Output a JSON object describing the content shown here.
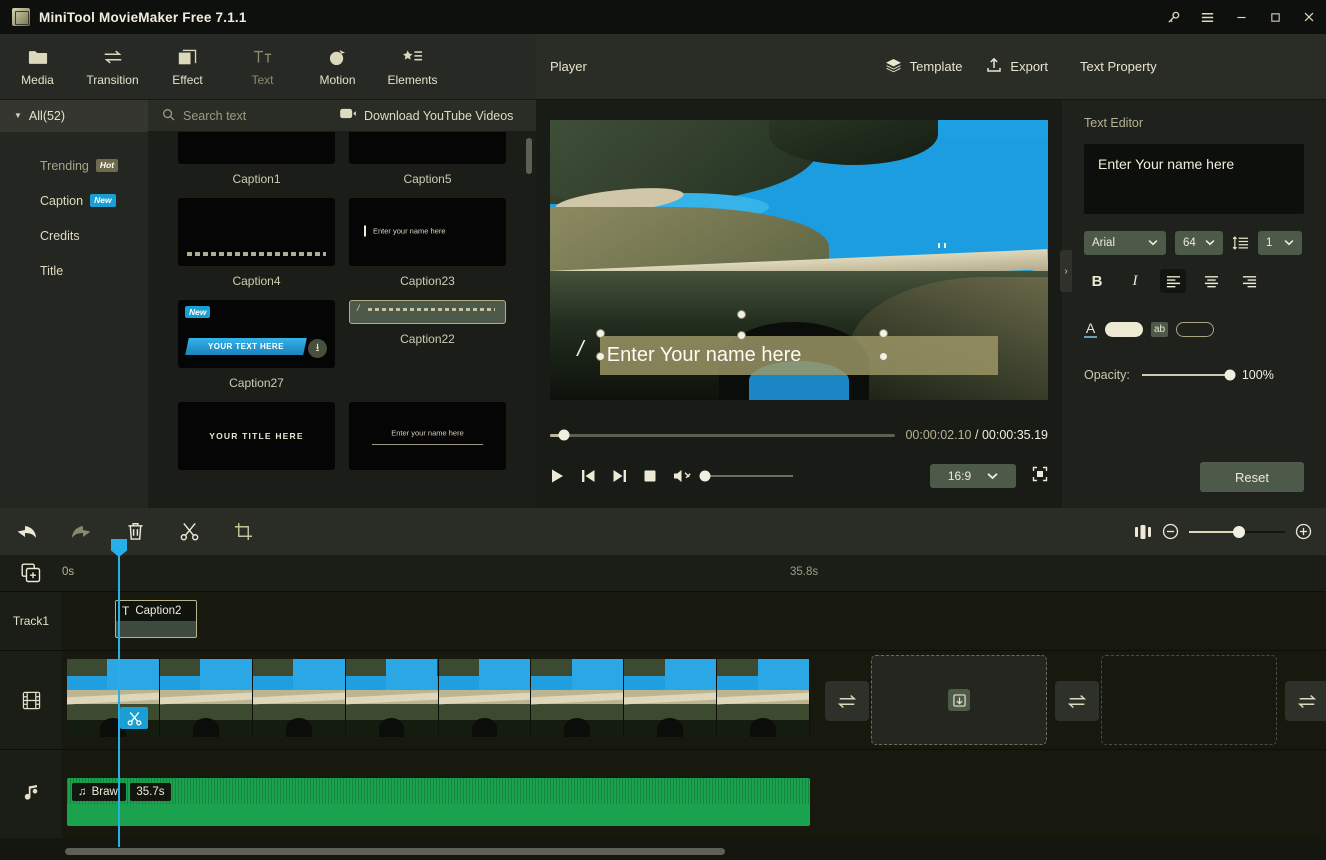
{
  "titlebar": {
    "app_title": "MiniTool MovieMaker Free 7.1.1",
    "buttons": [
      {
        "name": "key-icon",
        "label": "⚷"
      },
      {
        "name": "menu-icon",
        "label": "≡"
      },
      {
        "name": "minimize",
        "label": "—"
      },
      {
        "name": "maximize",
        "label": "☐"
      },
      {
        "name": "close",
        "label": "✕"
      }
    ]
  },
  "ribbon": {
    "items": [
      {
        "label": "Media",
        "icon": "folder-icon",
        "glyph": "🗀",
        "active": false
      },
      {
        "label": "Transition",
        "icon": "transition-icon",
        "glyph": "⇄",
        "active": false
      },
      {
        "label": "Effect",
        "icon": "effect-icon",
        "glyph": "❐",
        "active": false
      },
      {
        "label": "Text",
        "icon": "text-icon",
        "glyph": "Tт",
        "active": true
      },
      {
        "label": "Motion",
        "icon": "motion-icon",
        "glyph": "◕",
        "active": false
      },
      {
        "label": "Elements",
        "icon": "elements-icon",
        "glyph": "★",
        "active": false
      }
    ]
  },
  "library": {
    "all_label": "All(52)",
    "search_placeholder": "Search text",
    "download_label": "Download YouTube Videos",
    "categories": [
      {
        "label": "Trending",
        "badge": "Hot",
        "badge_kind": "hot"
      },
      {
        "label": "Caption",
        "badge": "New",
        "badge_kind": "new"
      },
      {
        "label": "Credits",
        "badge": "",
        "badge_kind": ""
      },
      {
        "label": "Title",
        "badge": "",
        "badge_kind": ""
      }
    ],
    "templates": [
      {
        "label": "Caption1",
        "style": "partial",
        "selected": false
      },
      {
        "label": "Caption5",
        "style": "partial",
        "selected": false
      },
      {
        "label": "Caption4",
        "style": "dashline",
        "selected": false,
        "text": ""
      },
      {
        "label": "Caption23",
        "style": "cursor",
        "selected": false,
        "text": "Enter your name here"
      },
      {
        "label": "Caption27",
        "style": "ribbon",
        "selected": false,
        "text": "YOUR TEXT HERE",
        "badge": "New"
      },
      {
        "label": "Caption22",
        "style": "slashline",
        "selected": true,
        "text": ""
      },
      {
        "label": "",
        "style": "title",
        "selected": false,
        "text": "YOUR TITLE HERE"
      },
      {
        "label": "",
        "style": "underline",
        "selected": false,
        "text": "Enter your name here"
      }
    ]
  },
  "player": {
    "title": "Player",
    "template_label": "Template",
    "export_label": "Export",
    "overlay_text": "Enter Your name here",
    "current_time": "00:00:02.10",
    "separator": "/",
    "total_time": "00:00:35.19",
    "progress_percent": 6,
    "aspect_ratio": "16:9",
    "controls": [
      {
        "name": "play-button",
        "glyph": "▶"
      },
      {
        "name": "previous-frame-button",
        "glyph": "⏮"
      },
      {
        "name": "next-frame-button",
        "glyph": "⏭"
      },
      {
        "name": "stop-button",
        "glyph": "■"
      },
      {
        "name": "mute-button",
        "glyph": "🔇"
      }
    ]
  },
  "text_property": {
    "panel_title": "Text Property",
    "section_label": "Text Editor",
    "editor_value": "Enter Your name here",
    "font_family": "Arial",
    "font_size": "64",
    "line_spacing": "1",
    "format_buttons": [
      {
        "name": "bold-button",
        "glyph": "B",
        "active": false
      },
      {
        "name": "italic-button",
        "glyph": "I",
        "active": false
      },
      {
        "name": "align-left-button",
        "glyph": "☰",
        "active": true
      },
      {
        "name": "align-center-button",
        "glyph": "☰",
        "active": false
      },
      {
        "name": "align-right-button",
        "glyph": "☰",
        "active": false
      }
    ],
    "text_color_label": "A",
    "text_color": "#eeead2",
    "bg_color_label": "ab",
    "bg_color": "transparent",
    "opacity_label": "Opacity:",
    "opacity_value": "100%",
    "reset_label": "Reset"
  },
  "timeline_toolbar": {
    "tools": [
      {
        "name": "undo-button",
        "glyph": "↶",
        "dim": false
      },
      {
        "name": "redo-button",
        "glyph": "↷",
        "dim": true
      },
      {
        "name": "delete-button",
        "glyph": "🗑",
        "dim": false
      },
      {
        "name": "split-button",
        "glyph": "✂",
        "dim": false
      },
      {
        "name": "crop-button",
        "glyph": "⌗",
        "dim": false
      }
    ],
    "zoom_percent": 52
  },
  "timeline": {
    "ruler_start": "0s",
    "ruler_mid": "35.8s",
    "tracks": [
      {
        "name": "Track1",
        "icon": ""
      },
      {
        "name": "",
        "icon": "film-icon"
      },
      {
        "name": "",
        "icon": "music-icon"
      }
    ],
    "caption_clip": {
      "label": "Caption2",
      "icon": "T"
    },
    "audio_clip": {
      "label": "Brawl",
      "duration": "35.7s",
      "icon": "♫"
    },
    "drop_zones": 2,
    "transition_buttons": 3
  }
}
